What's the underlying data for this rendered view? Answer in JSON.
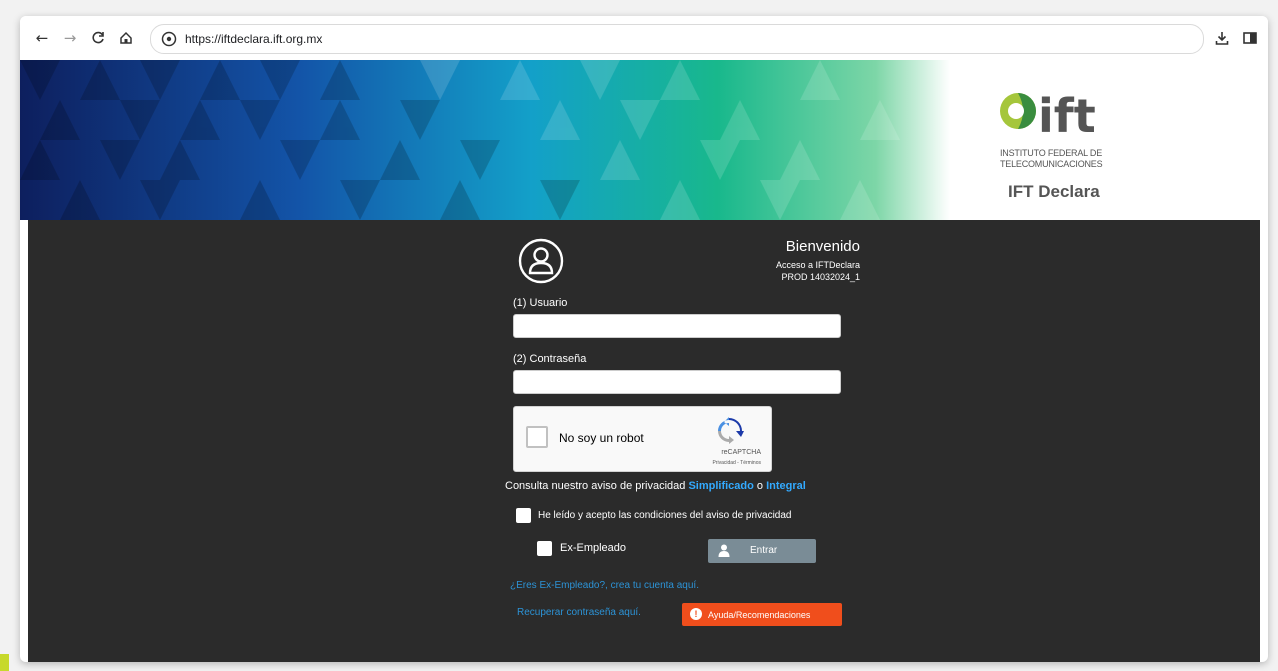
{
  "browser": {
    "url": "https://iftdeclara.ift.org.mx",
    "nav_icons": [
      "back-arrow-icon",
      "forward-arrow-icon",
      "reload-icon",
      "home-icon"
    ]
  },
  "banner": {
    "logo_text": "ift",
    "institute_line1": "INSTITUTO FEDERAL DE",
    "institute_line2": "TELECOMUNICACIONES",
    "app_name": "IFT Declara"
  },
  "login": {
    "welcome_title": "Bienvenido",
    "welcome_subtitle": "Acceso a IFTDeclara",
    "version": "PROD 14032024_1",
    "user_label": "(1) Usuario",
    "user_value": "",
    "password_label": "(2) Contraseña",
    "password_value": "",
    "captcha": {
      "label": "No soy un robot",
      "brand": "reCAPTCHA",
      "terms": "Privacidad - Términos"
    },
    "privacy_text": "Consulta nuestro aviso de privacidad",
    "privacy_link_simplified": "Simplificado",
    "privacy_or": "o",
    "privacy_link_integral": "Integral",
    "accept_label": "He leído y acepto las condiciones del aviso de privacidad",
    "ex_employee_label": "Ex-Empleado",
    "enter_label": "Entrar",
    "create_account_link": "¿Eres Ex-Empleado?, crea tu cuenta aquí.",
    "recover_link": "Recuperar contraseña aquí.",
    "help_button": "Ayuda/Recomendaciones"
  },
  "colors": {
    "background_dark": "#2b2b2b",
    "link_blue": "#33aaff",
    "help_orange": "#f04e1c",
    "enter_gray": "#7a8c96"
  }
}
